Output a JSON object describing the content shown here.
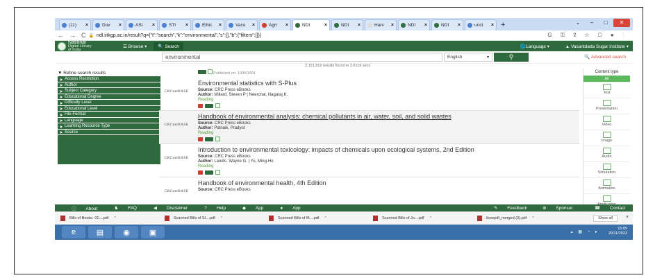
{
  "browser": {
    "tabs": [
      {
        "label": "(11)"
      },
      {
        "label": "Dov"
      },
      {
        "label": "ASt"
      },
      {
        "label": "STI"
      },
      {
        "label": "Ethic"
      },
      {
        "label": "Vaco"
      },
      {
        "label": "Agri"
      },
      {
        "label": "NDI",
        "active": true
      },
      {
        "label": "NDI"
      },
      {
        "label": "Harv"
      },
      {
        "label": "NDI"
      },
      {
        "label": "NDI"
      },
      {
        "label": "unct"
      }
    ],
    "new_tab": "+",
    "url": "ndl.iitkgp.ac.in/result?q={\"t\":\"search\",\"k\":\"environmental\",\"s\":[],\"b\":{\"filters\":[]}}"
  },
  "ndl": {
    "logo_line1": "National",
    "logo_line2": "Digital Library",
    "logo_line3": "of India",
    "browse": "Browse",
    "search_tab": "Search",
    "language": "Language",
    "institute": "Vasantdada Sugar Institute",
    "search_value": "environmental",
    "lang_select": "English",
    "search_btn_icon": "search-icon",
    "advanced": "Advanced search",
    "results_count": "2,151,812 results found in 2.6119 secs"
  },
  "sidebar": {
    "header": "Refine search results",
    "facets": [
      "Access Restriction",
      "Author",
      "Subject Category",
      "Educational Degree",
      "Difficulty Level",
      "Educational Level",
      "File Format",
      "Language",
      "Learning Resource Type",
      "Source"
    ]
  },
  "results": {
    "top_fragment": "Published on: 1990/1991",
    "items": [
      {
        "thumb": "CRCnetBASE",
        "title": "Environmental statistics with S-Plus",
        "source": "CRC Press eBooks",
        "author": "Millard, Steven P | Neerchal, Nagaraj K.",
        "type": "Reading"
      },
      {
        "thumb": "CRCnetBASE",
        "title": "Handbook of environmental analysis: chemical pollutants in air, water, soil, and solid wastes",
        "source": "CRC Press eBooks",
        "author": "Patnaik, Pradyot",
        "type": "Reading"
      },
      {
        "thumb": "CRCnetBASE",
        "title": "Introduction to environmental toxicology: impacts of chemicals upon ecological systems, 2nd Edition",
        "source": "CRC Press eBooks",
        "author": "Landis, Wayne G. | Yu, Ming-Ho",
        "type": "Reading"
      },
      {
        "thumb": "CRCnetBASE",
        "title": "Handbook of environmental health, 4th Edition",
        "source": "CRC Press eBooks",
        "author": "",
        "type": ""
      }
    ],
    "labels": {
      "source": "Source:",
      "author": "Author:"
    }
  },
  "content_type": {
    "header": "Content type",
    "items": [
      "All",
      "Text",
      "Presentation",
      "Video",
      "Image",
      "Audio",
      "Simulation",
      "Animation",
      "Application"
    ]
  },
  "footer": {
    "about": "About",
    "faq": "FAQ",
    "disclaimer": "Disclaimer",
    "help": "Help",
    "app1": "App",
    "app2": "App",
    "feedback": "Feedback",
    "sponsor": "Sponsor",
    "contact": "Contact"
  },
  "downloads": {
    "files": [
      "Bills of Books- 01....pdf",
      "Scanned Bills of Sl....pdf",
      "Scanned Bills of M....pdf",
      "Scanned Bills of Jo....pdf",
      "ilovepdf_merged (3).pdf"
    ],
    "show_all": "Show all",
    "close": "×"
  },
  "taskbar": {
    "time": "15:05",
    "date": "29/11/2023"
  },
  "colors": {
    "ndl_green": "#2f6a3e",
    "tab_blue": "#c9dcf3",
    "taskbar": "#3b6fa8",
    "adv_red": "#d94b3a"
  }
}
